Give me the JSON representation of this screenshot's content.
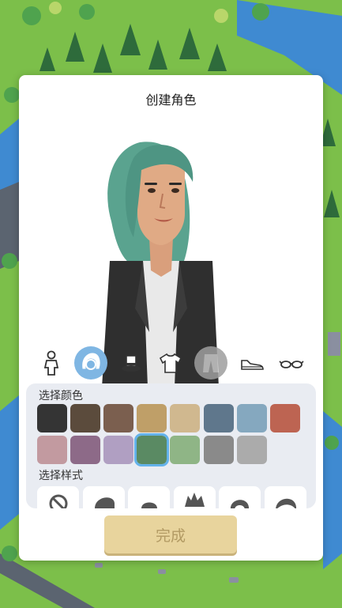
{
  "modal": {
    "title": "创建角色",
    "color_label": "选择颜色",
    "style_label": "选择样式",
    "done_label": "完成"
  },
  "categories": [
    {
      "name": "body-icon",
      "active": false
    },
    {
      "name": "hair-icon",
      "active": true
    },
    {
      "name": "hat-icon",
      "active": false
    },
    {
      "name": "shirt-icon",
      "active": false
    },
    {
      "name": "pants-icon",
      "active": false
    },
    {
      "name": "shoe-icon",
      "active": false
    },
    {
      "name": "glasses-icon",
      "active": false
    }
  ],
  "colors": {
    "row1": [
      "#343434",
      "#5b4b3c",
      "#7b5f4f",
      "#bf9f68",
      "#d0b88f",
      "#5f778c",
      "#85a8bf",
      "#bd6452"
    ],
    "row2": [
      "#c29aa0",
      "#8d6a88",
      "#b09fc2",
      "#5a8a63",
      "#8fb586",
      "#8a8a8a",
      "#ababab"
    ],
    "selected": "#5a8a63"
  },
  "style_options": [
    "hairstyle-1",
    "hairstyle-2",
    "hairstyle-3",
    "hairstyle-4",
    "hairstyle-5",
    "hairstyle-6"
  ],
  "avatar": {
    "hair_color": "#5aa38f",
    "jacket_color": "#2f2f2f",
    "shirt_color": "#e9e9e9",
    "skin_color": "#d99f7c"
  }
}
